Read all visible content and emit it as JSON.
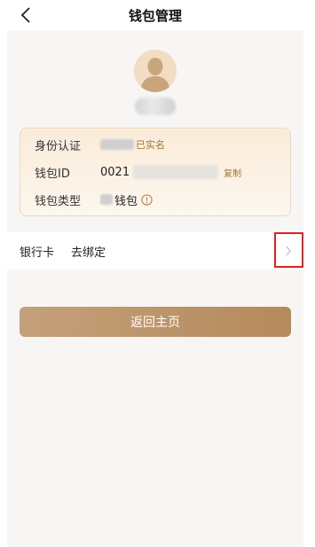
{
  "nav": {
    "title": "钱包管理"
  },
  "wallet": {
    "identity_label": "身份认证",
    "identity_status": "已实名",
    "wallet_id_label": "钱包ID",
    "wallet_id_value": "0021",
    "copy_label": "复制",
    "wallet_type_label": "钱包类型",
    "wallet_type_value": "钱包"
  },
  "bank_card": {
    "label": "银行卡",
    "unbind_label": "去绑定"
  },
  "home_button": {
    "label": "返回主页"
  },
  "colors": {
    "accent": "#a4742f",
    "button_start": "#c4a07a",
    "button_end": "#b58a5c",
    "highlight_border": "#e02020"
  }
}
